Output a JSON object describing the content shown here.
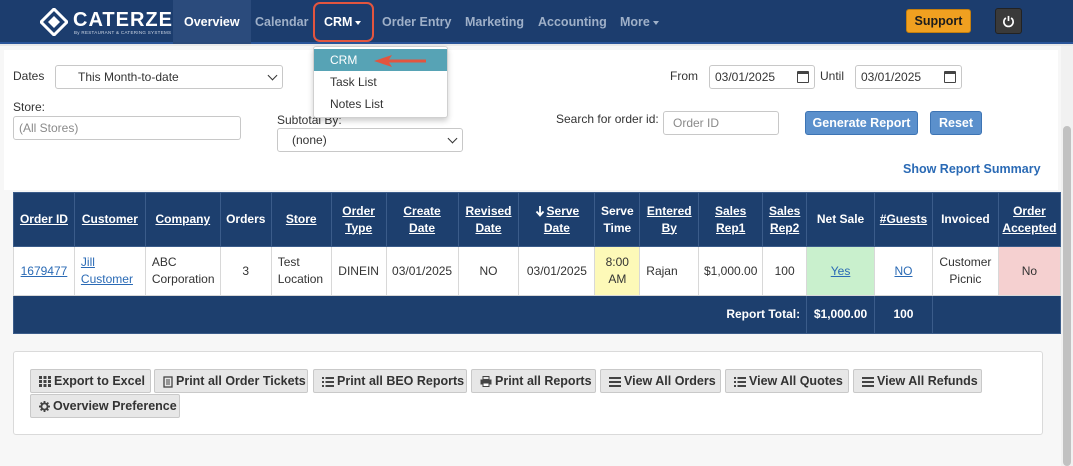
{
  "brand": {
    "name": "CATERZEN",
    "tagline": "By RESTAURANT & CATERING SYSTEMS"
  },
  "nav": {
    "items": [
      {
        "label": "Overview",
        "active": true
      },
      {
        "label": "Calendar"
      },
      {
        "label": "CRM"
      },
      {
        "label": "Order Entry"
      },
      {
        "label": "Marketing"
      },
      {
        "label": "Accounting"
      },
      {
        "label": "More"
      }
    ],
    "support_label": "Support"
  },
  "crm_menu": {
    "items": [
      "CRM",
      "Task List",
      "Notes List"
    ],
    "highlighted": "CRM"
  },
  "filters": {
    "dates_label": "Dates",
    "dates_value": "This Month-to-date",
    "store_label": "Store:",
    "store_placeholder": "(All Stores)",
    "subtotal_label": "Subtotal By:",
    "subtotal_value": "(none)",
    "from_label": "From",
    "from_value": "03/01/2025",
    "until_label": "Until",
    "until_value": "03/01/2025",
    "search_label": "Search for order id:",
    "search_placeholder": "Order ID",
    "generate_label": "Generate Report",
    "reset_label": "Reset",
    "summary_link": "Show Report Summary"
  },
  "table": {
    "headers": {
      "order_id": "Order ID",
      "customer": "Customer",
      "company": "Company",
      "orders": "Orders",
      "store": "Store",
      "order_type": "Order Type",
      "create_date": "Create Date",
      "revised_date": "Revised Date",
      "serve_date": "Serve Date",
      "serve_time": "Serve Time",
      "entered_by": "Entered By",
      "sales_rep1": "Sales Rep1",
      "sales_rep2": "Sales Rep2",
      "net_sale": "Net Sale",
      "guests": "#Guests",
      "invoiced": "Invoiced",
      "order_accepted": "Order Accepted"
    },
    "row": {
      "order_id": "1679477",
      "customer": "Jill Customer",
      "company": "ABC Corporation",
      "orders": "3",
      "store": "Test Location",
      "order_type": "DINEIN",
      "create_date": "03/01/2025",
      "revised_date": "NO",
      "serve_date": "03/01/2025",
      "serve_time": "8:00 AM",
      "entered_by": "Rajan",
      "sales_rep1": "$1,000.00",
      "sales_rep2": "100",
      "net_sale": "Yes",
      "guests": "NO",
      "invoiced": "Customer Picnic",
      "order_accepted": "No"
    },
    "total": {
      "label": "Report Total:",
      "amount": "$1,000.00",
      "guests": "100"
    }
  },
  "actions": [
    "Export to Excel",
    "Print all Order Tickets",
    "Print all BEO Reports",
    "Print all Reports",
    "View All Orders",
    "View All Quotes",
    "View All Refunds",
    "Overview Preference"
  ],
  "colors": {
    "nav_bg": "#1c3d6e",
    "support": "#f0a020",
    "primary_button": "#5b90cc",
    "menu_highlight": "#57a3b5",
    "annotation": "#e2553f",
    "cell_yellow": "#fdf9b8",
    "cell_green": "#c9f0cd",
    "cell_pink": "#f5d0d0"
  }
}
